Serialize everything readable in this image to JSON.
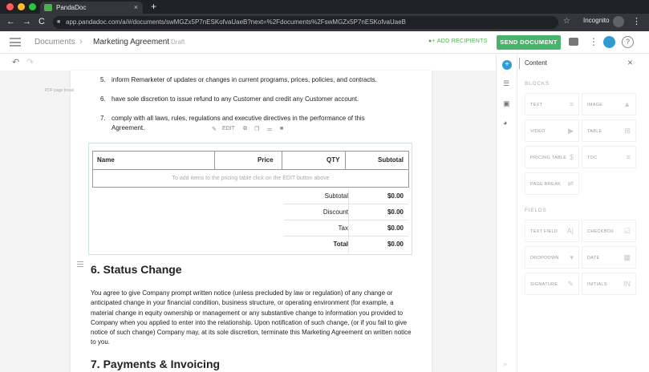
{
  "browser": {
    "tab_title": "PandaDoc",
    "tab_close": "×",
    "new_tab": "+",
    "back": "←",
    "forward": "→",
    "reload": "C",
    "url": "app.pandadoc.com/a/#/documents/swMGZx5P7nESKofvaUaeB?next=%2Fdocuments%2FswMGZx5P7nESKofvaUaeB",
    "bookmark": "☆",
    "profile_label": "Incognito",
    "menu": "⋮"
  },
  "header": {
    "crumb_documents": "Documents",
    "crumb_sep": "›",
    "doc_title": "Marketing Agreement",
    "status": "Draft",
    "add_recipients": "ADD RECIPIENTS",
    "send_document": "SEND DOCUMENT",
    "more": "⋮",
    "help": "?"
  },
  "toolbar": {
    "undo": "↶",
    "redo": "↷"
  },
  "canvas": {
    "pdf_note": "PDF page break",
    "list_items": [
      {
        "num": "5.",
        "text": "inform Remarketer of updates or changes in current programs, prices, policies, and contracts."
      },
      {
        "num": "6.",
        "text": "have sole discretion to issue refund to any Customer and credit any Customer account."
      },
      {
        "num": "7.",
        "text": "comply with all laws, rules, regulations and executive directives in the performance of this Agreement."
      }
    ],
    "block_tools": {
      "edit": "EDIT"
    },
    "pricing_table": {
      "headers": [
        "Name",
        "Price",
        "QTY",
        "Subtotal"
      ],
      "empty_text": "To add items to the pricing table click on the EDIT button above",
      "summary": [
        {
          "label": "Subtotal",
          "value": "$0.00"
        },
        {
          "label": "Discount",
          "value": "$0.00"
        },
        {
          "label": "Tax",
          "value": "$0.00"
        },
        {
          "label": "Total",
          "value": "$0.00"
        }
      ]
    },
    "section6_title": "6. Status Change",
    "section6_text": "You agree to give Company prompt written notice (unless precluded by law or regulation) of any change or anticipated change in your financial condition, business structure, or operating environment (for example, a material change in equity ownership or management or any substantive change to information you provided to Company when you applied to enter into the relationship. Upon notification of such change, (or if you fail to give notice of such change) Company may, at its sole discretion, terminate this Marketing Agreement on written notice to you.",
    "section7_title": "7. Payments & Invoicing"
  },
  "panel": {
    "title": "Content",
    "close": "×",
    "blocks_label": "BLOCKS",
    "blocks": [
      {
        "label": "TEXT",
        "icon": "≡"
      },
      {
        "label": "IMAGE",
        "icon": "▲"
      },
      {
        "label": "VIDEO",
        "icon": "▶"
      },
      {
        "label": "TABLE",
        "icon": "⊞"
      },
      {
        "label": "PRICING TABLE",
        "icon": "$"
      },
      {
        "label": "TOC",
        "icon": "≡"
      },
      {
        "label": "PAGE BREAK",
        "icon": "⇌"
      }
    ],
    "fields_label": "FIELDS",
    "fields": [
      {
        "label": "TEXT FIELD",
        "icon": "A|"
      },
      {
        "label": "CHECKBOX",
        "icon": "☑"
      },
      {
        "label": "DROPDOWN",
        "icon": "▾"
      },
      {
        "label": "DATE",
        "icon": "▦"
      },
      {
        "label": "SIGNATURE",
        "icon": "✎"
      },
      {
        "label": "INITIALS",
        "icon": "IN"
      }
    ],
    "collapse": "»"
  }
}
